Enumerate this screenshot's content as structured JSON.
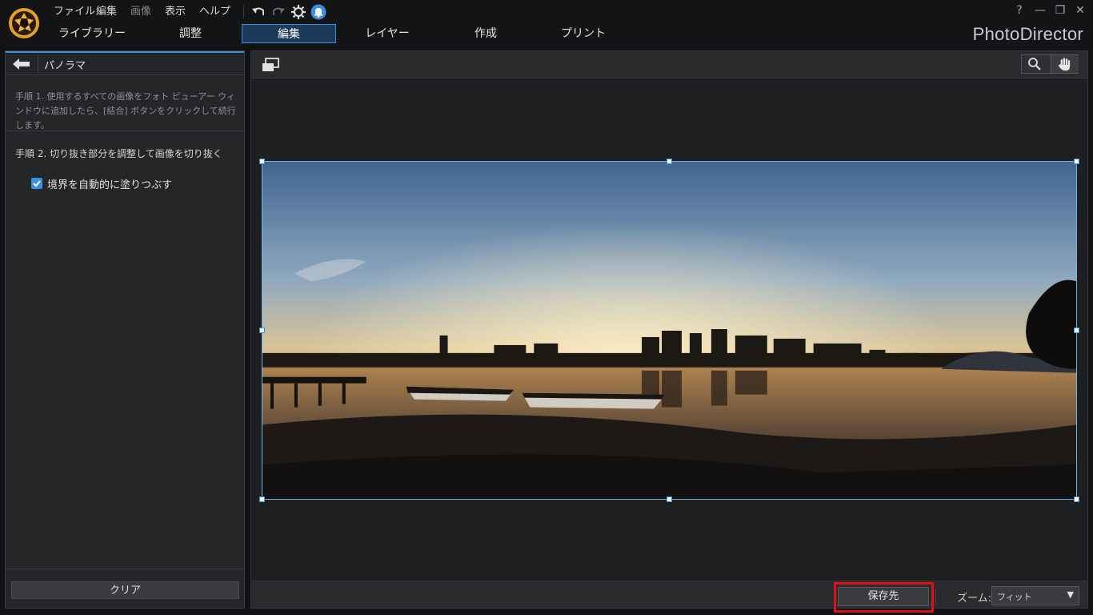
{
  "menu": {
    "items": [
      {
        "label": "ファイル",
        "disabled": false
      },
      {
        "label": "編集",
        "disabled": false
      },
      {
        "label": "画像",
        "disabled": true
      },
      {
        "label": "表示",
        "disabled": false
      },
      {
        "label": "ヘルプ",
        "disabled": false
      }
    ]
  },
  "toolbar_icons": [
    "undo-icon",
    "redo-icon",
    "settings-icon",
    "notification-bell-icon"
  ],
  "window_controls": {
    "help": "?",
    "minimize": "—",
    "restore": "❐",
    "close": "✕"
  },
  "tabs": [
    {
      "label": "ライブラリー",
      "active": false
    },
    {
      "label": "調整",
      "active": false
    },
    {
      "label": "編集",
      "active": true
    },
    {
      "label": "レイヤー",
      "active": false
    },
    {
      "label": "作成",
      "active": false
    },
    {
      "label": "プリント",
      "active": false
    }
  ],
  "brand": "PhotoDirector",
  "panel": {
    "title": "パノラマ",
    "step1": "手順 1. 使用するすべての画像をフォト ビューアー ウィンドウに追加したら、[結合] ボタンをクリックして続行します。",
    "step2": "手順 2. 切り抜き部分を調整して画像を切り抜く",
    "autofill": {
      "label": "境界を自動的に塗りつぶす",
      "checked": true
    },
    "clear_label": "クリア"
  },
  "bottom": {
    "save_label": "保存先",
    "zoom_label": "ズーム:",
    "zoom_value": "フィット"
  },
  "colors": {
    "accent": "#3b8ee0",
    "highlight": "#e0101a",
    "background": "#1e1f21"
  }
}
